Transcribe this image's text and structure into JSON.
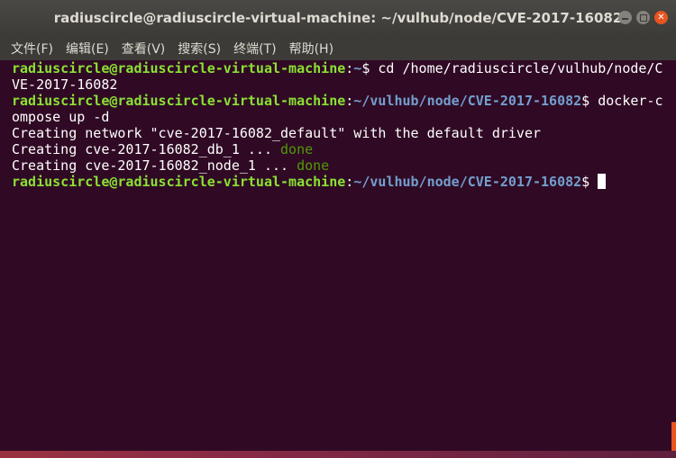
{
  "window": {
    "title": "radiuscircle@radiuscircle-virtual-machine: ~/vulhub/node/CVE-2017-16082",
    "buttons": {
      "minimize": "minimize",
      "maximize": "maximize",
      "close": "close"
    }
  },
  "menu": [
    "文件(F)",
    "编辑(E)",
    "查看(V)",
    "搜索(S)",
    "终端(T)",
    "帮助(H)"
  ],
  "terminal": {
    "prompt_user": "radiuscircle@radiuscircle-virtual-machine",
    "line1": {
      "path": "~",
      "cmd": " cd /home/radiuscircle/vulhub/node/C"
    },
    "line2": "VE-2017-16082",
    "line3": {
      "path": "~/vulhub/node/CVE-2017-16082",
      "cmd": " docker-c"
    },
    "line4": "ompose up -d",
    "line5": "Creating network \"cve-2017-16082_default\" with the default driver",
    "line6": {
      "text": "Creating cve-2017-16082_db_1 ... ",
      "status": "done"
    },
    "line7": {
      "text": "Creating cve-2017-16082_node_1 ... ",
      "status": "done"
    },
    "line8": {
      "path": "~/vulhub/node/CVE-2017-16082",
      "cmd": " "
    }
  },
  "colors": {
    "terminal_bg": "#300a24",
    "user": "#8ae234",
    "path": "#729fcf",
    "done": "#4e9a06",
    "accent": "#e95420"
  }
}
